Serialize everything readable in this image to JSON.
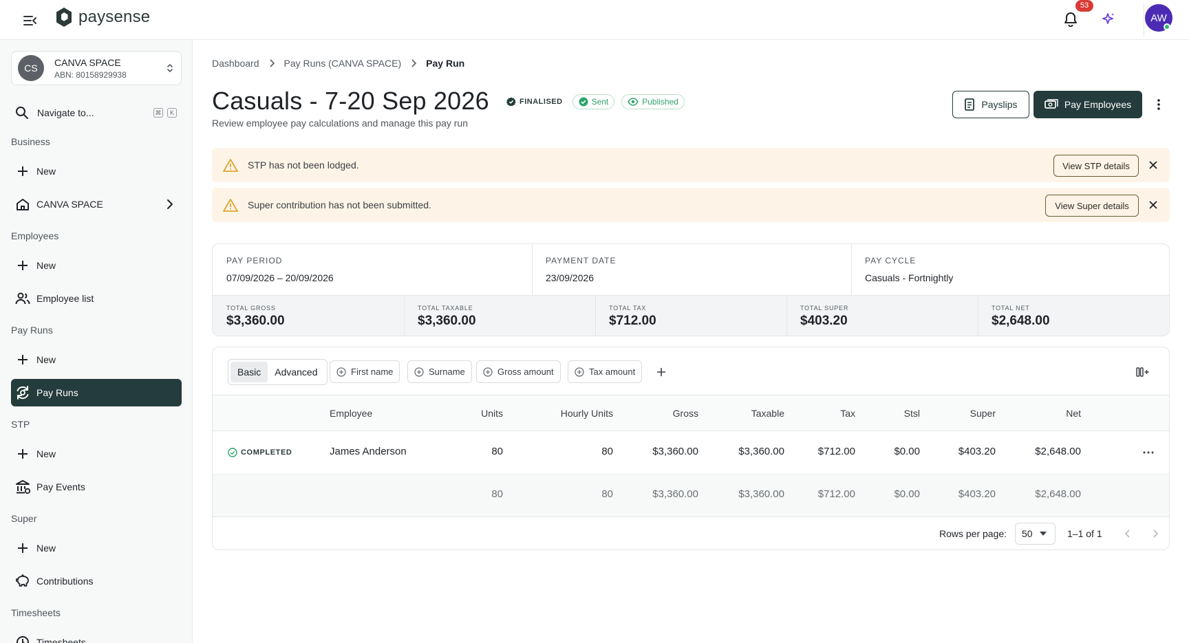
{
  "brand": {
    "name": "paysense",
    "accent": "#243c3b"
  },
  "topbar": {
    "notification_count": "53",
    "user_initials": "AW"
  },
  "sidebar": {
    "org": {
      "initials": "CS",
      "name": "CANVA SPACE",
      "abn": "ABN: 80158929938"
    },
    "navigate": {
      "label": "Navigate to...",
      "shortcut_mod": "⌘",
      "shortcut_key": "K"
    },
    "sections": {
      "business": "Business",
      "employees": "Employees",
      "pay_runs": "Pay Runs",
      "stp": "STP",
      "super": "Super",
      "timesheets": "Timesheets"
    },
    "items": {
      "business_new": "New",
      "canva_space": "CANVA SPACE",
      "employees_new": "New",
      "employee_list": "Employee list",
      "pay_runs_new": "New",
      "pay_runs": "Pay Runs",
      "stp_new": "New",
      "pay_events": "Pay Events",
      "super_new": "New",
      "contributions": "Contributions",
      "timesheets": "Timesheets"
    }
  },
  "breadcrumb": [
    "Dashboard",
    "Pay Runs (CANVA SPACE)",
    "Pay Run"
  ],
  "page": {
    "title": "Casuals - 7-20 Sep 2026",
    "subtitle": "Review employee pay calculations and manage this pay run",
    "status": "FINALISED",
    "badges": [
      "Sent",
      "Published"
    ],
    "payslips_button": "Payslips",
    "pay_button": "Pay Employees"
  },
  "alerts": [
    {
      "message": "STP has not been lodged.",
      "action": "View STP details"
    },
    {
      "message": "Super contribution has not been submitted.",
      "action": "View Super details"
    }
  ],
  "summary": {
    "pay_period_label": "PAY PERIOD",
    "pay_period": "07/09/2026 – 20/09/2026",
    "payment_date_label": "PAYMENT DATE",
    "payment_date": "23/09/2026",
    "pay_cycle_label": "PAY CYCLE",
    "pay_cycle": "Casuals - Fortnightly",
    "totals": [
      {
        "label": "TOTAL GROSS",
        "value": "$3,360.00"
      },
      {
        "label": "TOTAL TAXABLE",
        "value": "$3,360.00"
      },
      {
        "label": "TOTAL TAX",
        "value": "$712.00"
      },
      {
        "label": "TOTAL SUPER",
        "value": "$403.20"
      },
      {
        "label": "TOTAL NET",
        "value": "$2,648.00"
      }
    ]
  },
  "table": {
    "view_tabs": [
      "Basic",
      "Advanced"
    ],
    "filters": [
      "First name",
      "Surname",
      "Gross amount",
      "Tax amount"
    ],
    "columns": [
      "Employee",
      "Units",
      "Hourly Units",
      "Gross",
      "Taxable",
      "Tax",
      "Stsl",
      "Super",
      "Net"
    ],
    "rows": [
      {
        "status": "COMPLETED",
        "employee": "James Anderson",
        "units": "80",
        "hourly_units": "80",
        "gross": "$3,360.00",
        "taxable": "$3,360.00",
        "tax": "$712.00",
        "stsl": "$0.00",
        "super": "$403.20",
        "net": "$2,648.00"
      }
    ],
    "totals": {
      "units": "80",
      "hourly_units": "80",
      "gross": "$3,360.00",
      "taxable": "$3,360.00",
      "tax": "$712.00",
      "stsl": "$0.00",
      "super": "$403.20",
      "net": "$2,648.00"
    },
    "pagination": {
      "rows_per_page_label": "Rows per page:",
      "rows_per_page": "50",
      "range": "1–1 of 1"
    }
  }
}
